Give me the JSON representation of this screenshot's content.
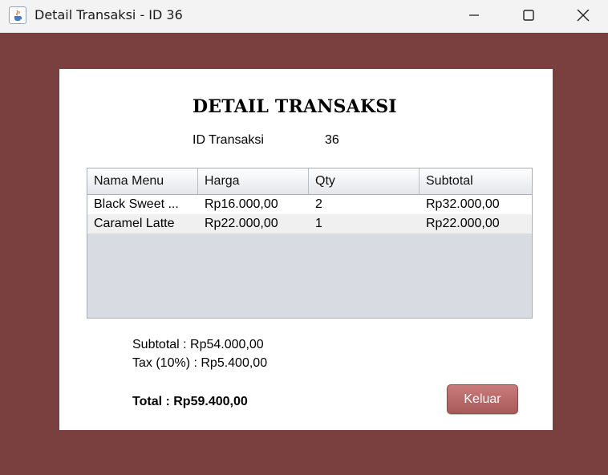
{
  "window": {
    "title": "Detail Transaksi - ID 36",
    "icon": "java-cup-icon"
  },
  "header": {
    "heading": "DETAIL TRANSAKSI",
    "id_label": "ID Transaksi",
    "id_value": "36"
  },
  "table": {
    "columns": [
      "Nama Menu",
      "Harga",
      "Qty",
      "Subtotal"
    ],
    "rows": [
      [
        "Black Sweet ...",
        "Rp16.000,00",
        "2",
        "Rp32.000,00"
      ],
      [
        "Caramel Latte",
        "Rp22.000,00",
        "1",
        "Rp22.000,00"
      ]
    ]
  },
  "summary": {
    "subtotal": "Subtotal : Rp54.000,00",
    "tax": "Tax (10%) : Rp5.400,00",
    "total": "Total : Rp59.400,00"
  },
  "actions": {
    "keluar_label": "Keluar"
  },
  "colors": {
    "frame_background": "#7a4040",
    "button_accent": "#b86a6a"
  }
}
